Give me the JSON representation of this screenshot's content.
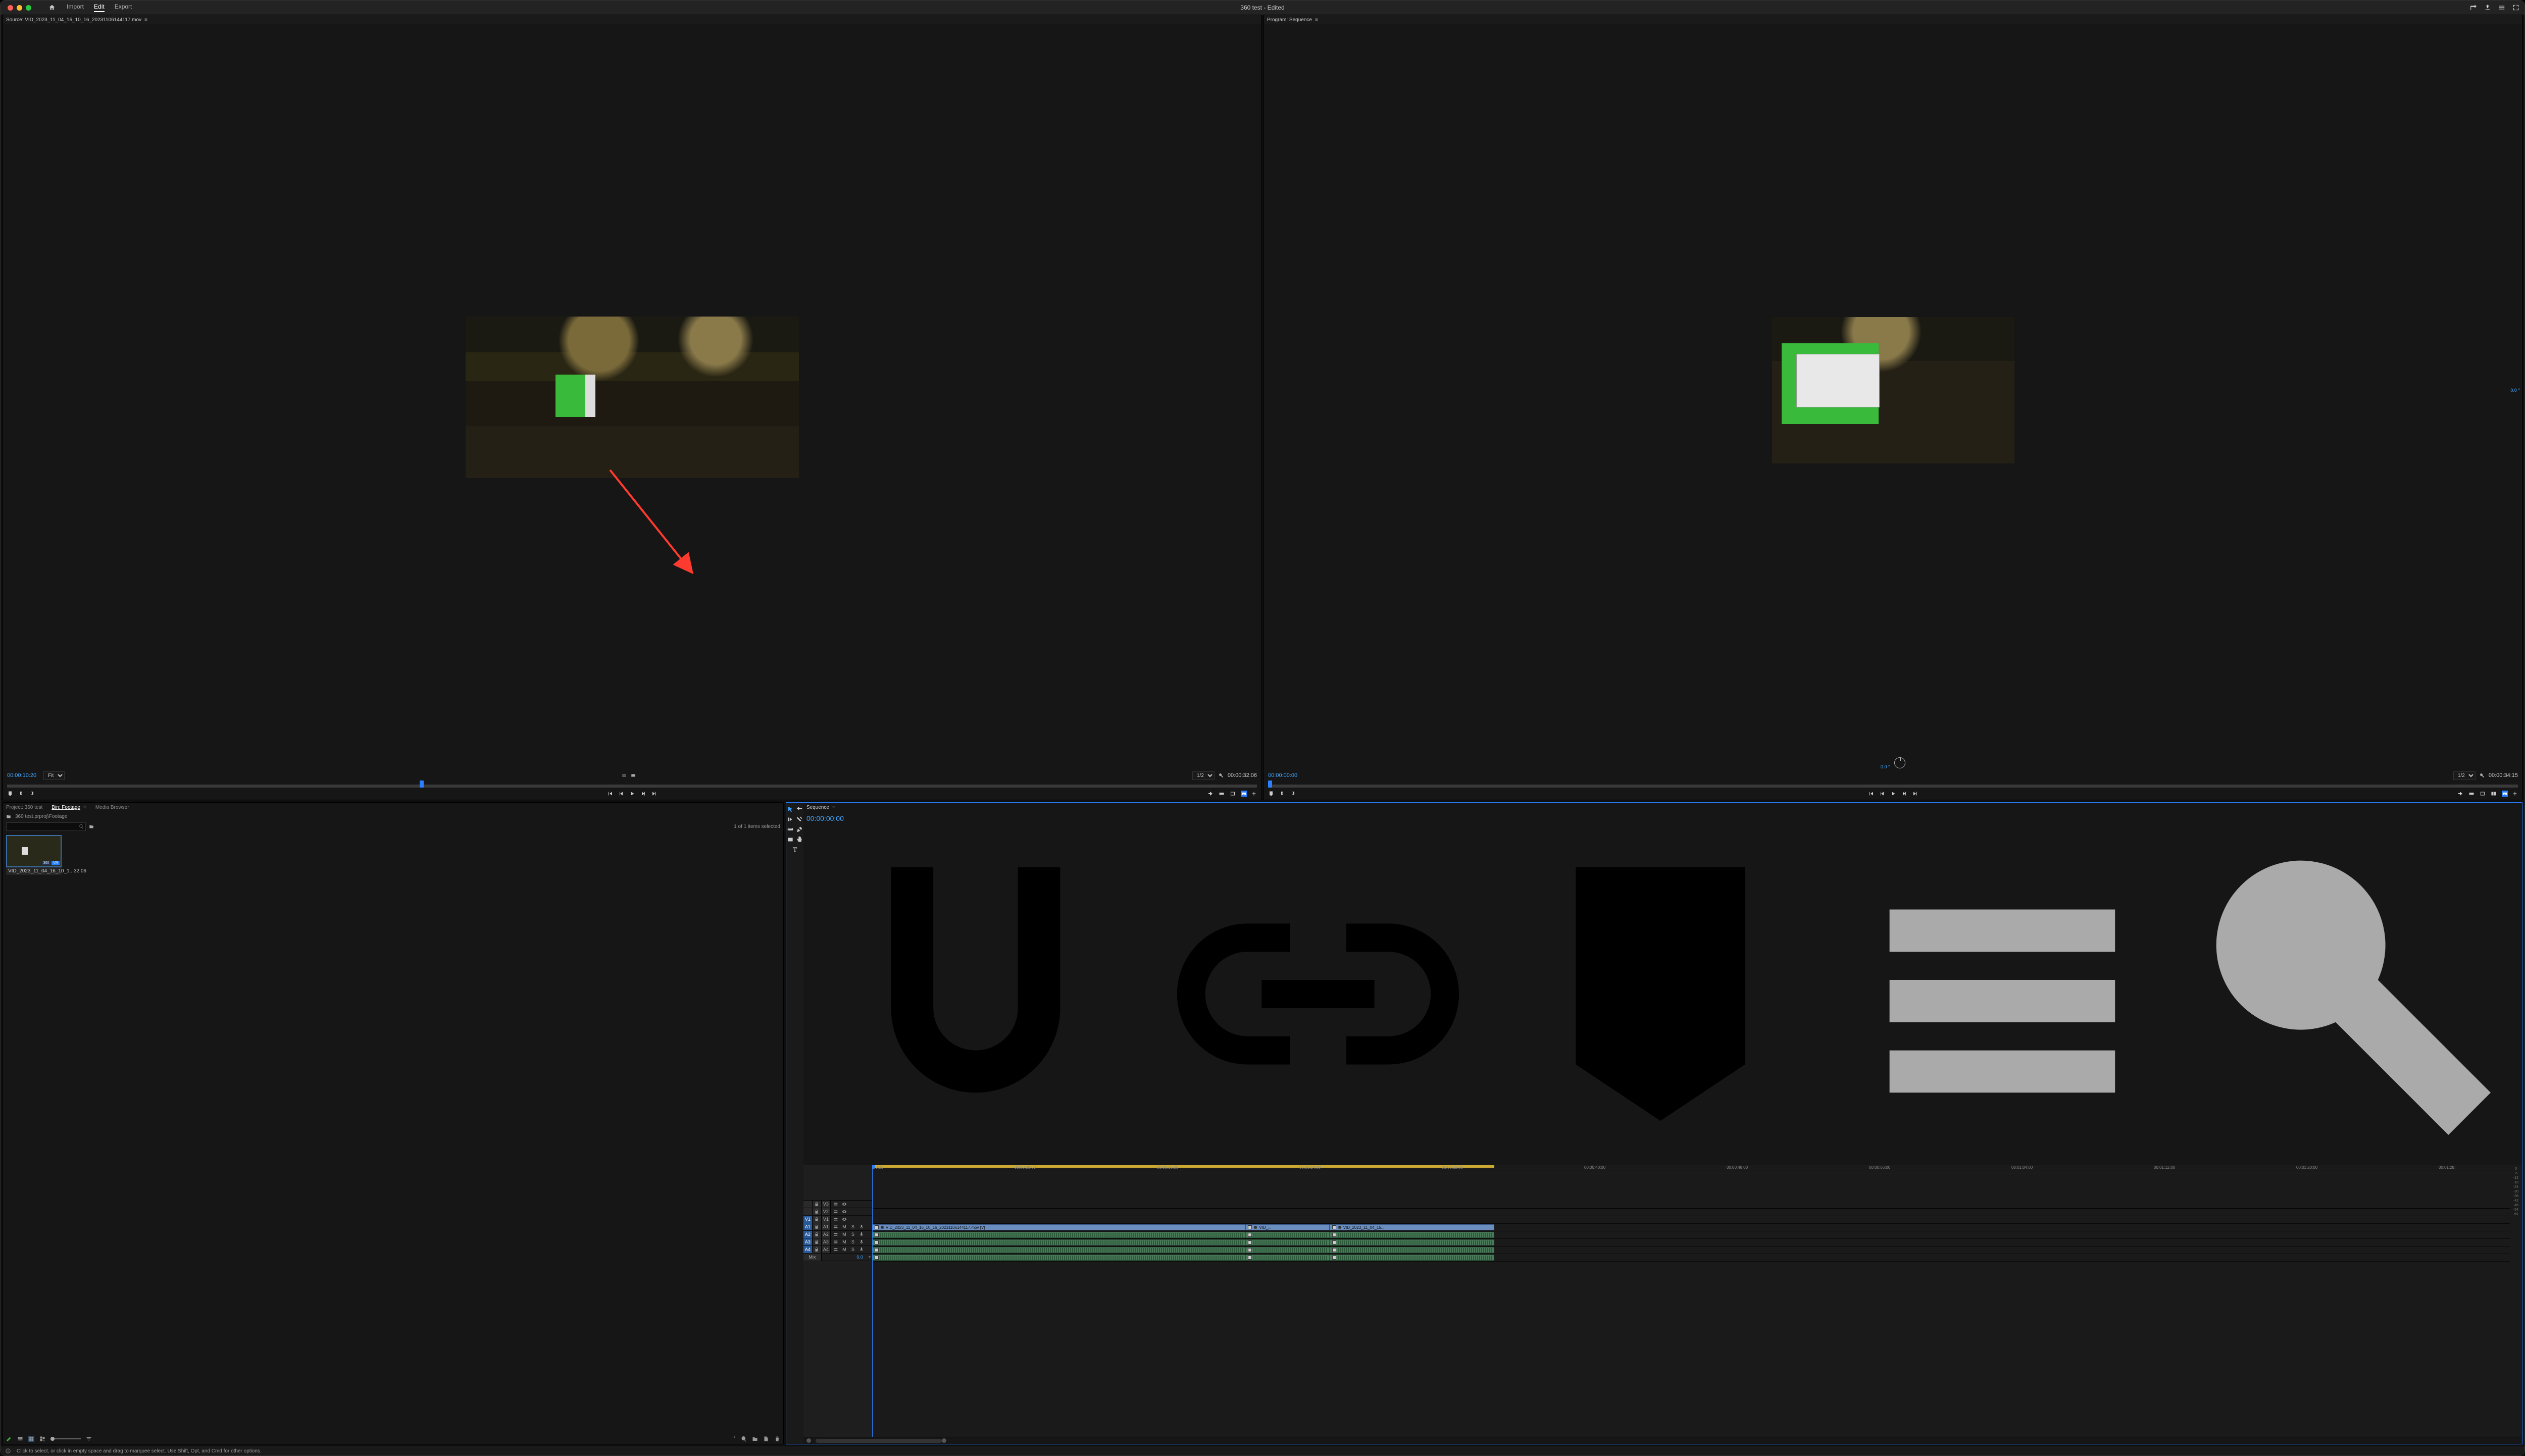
{
  "title": {
    "project": "360 test",
    "edited_suffix": " - Edited"
  },
  "menu": {
    "import": "Import",
    "edit": "Edit",
    "export": "Export"
  },
  "source": {
    "tab_label": "Source: VID_2023_11_04_16_10_16_20231106144117.mov",
    "timecode": "00:00:10:20",
    "fit": "Fit",
    "resolution": "1/2",
    "duration": "00:00:32:06"
  },
  "program": {
    "tab_label": "Program: Sequence",
    "timecode": "00:00:00:00",
    "resolution": "1/2",
    "duration": "00:00:34:15",
    "vr_angle_h": "0.0 °",
    "vr_angle_v": "0.0 °"
  },
  "project_panel": {
    "tab_project": "Project: 360 test",
    "tab_bin": "Bin: Footage",
    "tab_media": "Media Browser",
    "path": "360 test.prproj\\Footage",
    "search_placeholder": "",
    "selection": "1 of 1 items selected",
    "clips": [
      {
        "name": "VID_2023_11_04_16_10_1...",
        "dur": "32:06",
        "badge_360": "360",
        "badge_vr": "VR"
      }
    ]
  },
  "timeline": {
    "tab": "Sequence",
    "timecode": "00:00:00:00",
    "ruler": [
      "  :00:00",
      "00:00:08:00",
      "00:00:16:00",
      "00:00:24:00",
      "00:00:32:00",
      "00:00:40:00",
      "00:00:48:00",
      "00:00:56:00",
      "00:01:04:00",
      "00:01:12:00",
      "00:01:20:00",
      "00:01:28:"
    ],
    "video_tracks": [
      {
        "patch": "",
        "name": "V3"
      },
      {
        "patch": "",
        "name": "V2"
      },
      {
        "patch": "V1",
        "name": "V1"
      }
    ],
    "audio_tracks": [
      {
        "patch": "A1",
        "name": "A1"
      },
      {
        "patch": "A2",
        "name": "A2"
      },
      {
        "patch": "A3",
        "name": "A3"
      },
      {
        "patch": "A4",
        "name": "A4"
      }
    ],
    "mix_label": "Mix",
    "mix_value": "0.0",
    "clips": [
      {
        "track": "V1",
        "start_pct": 0,
        "end_pct": 60,
        "label": "VID_2023_11_04_16_10_16_20231106144117.mov [V]"
      },
      {
        "track": "V1",
        "start_pct": 60,
        "end_pct": 73.5,
        "label": "VID_..."
      },
      {
        "track": "V1",
        "start_pct": 73.5,
        "end_pct": 100,
        "label": "VID_2023_11_04_16..."
      }
    ],
    "audio_meter_ticks": [
      "0",
      "-6",
      "-12",
      "-18",
      "-24",
      "-30",
      "-36",
      "-42",
      "-48",
      "-54",
      "dB"
    ]
  },
  "status": {
    "hint": "Click to select, or click in empty space and drag to marquee select. Use Shift, Opt, and Cmd for other options."
  }
}
